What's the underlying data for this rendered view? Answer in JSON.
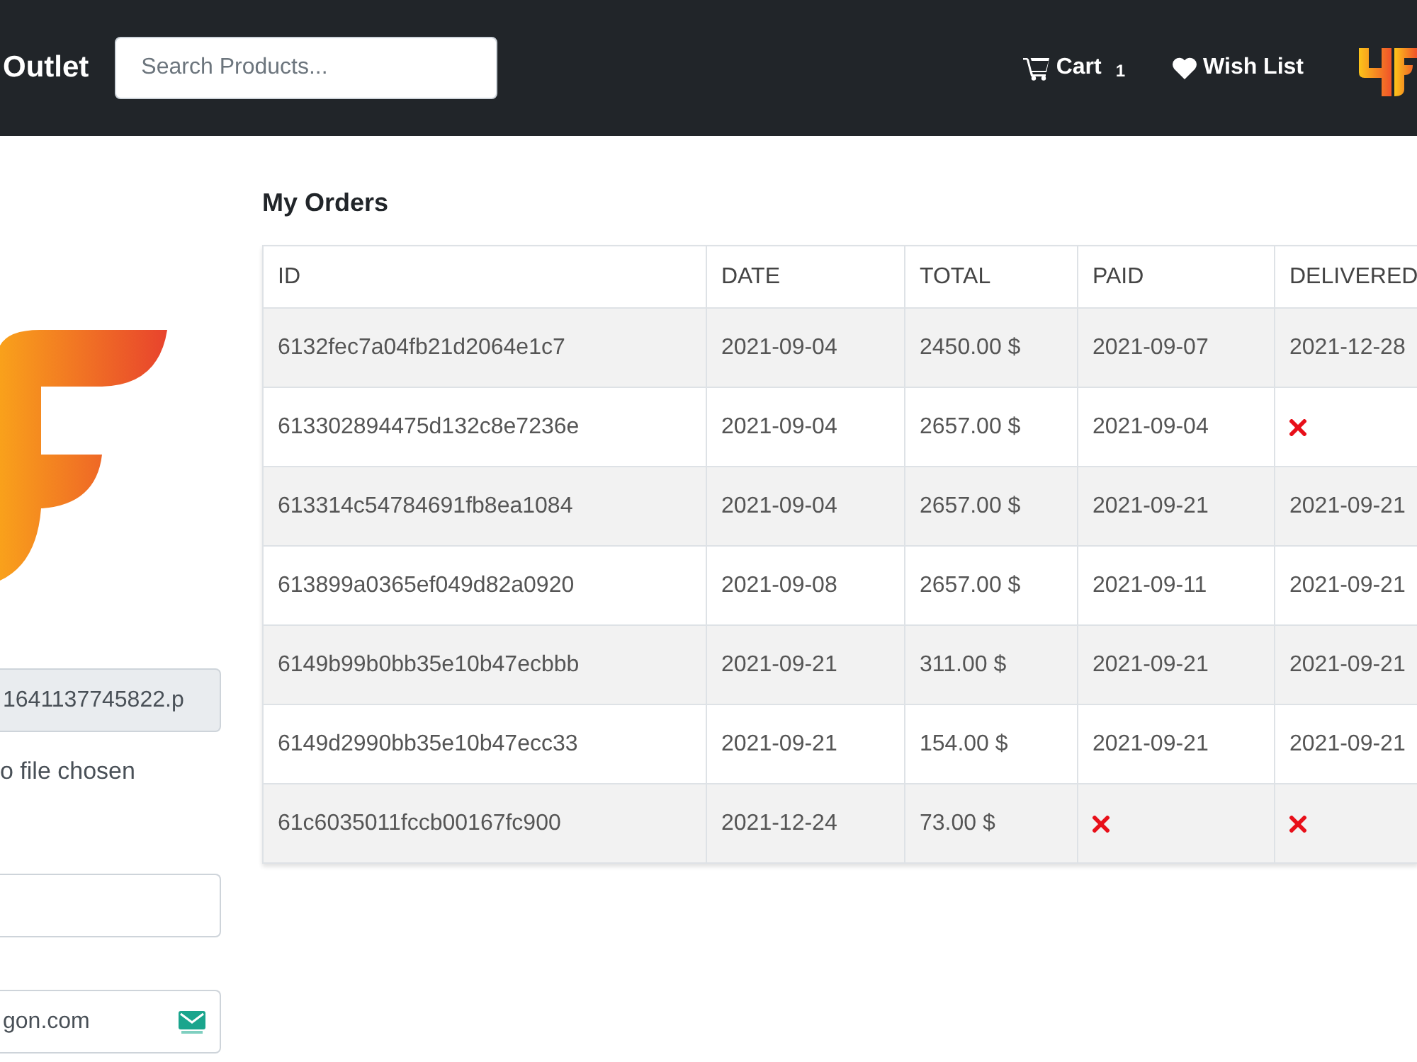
{
  "navbar": {
    "brand": "Outlet",
    "search": {
      "placeholder": "Search Products..."
    },
    "links": [
      {
        "kind": "cart",
        "label": "Cart",
        "badge": "1"
      },
      {
        "kind": "wishlist",
        "label": "Wish List"
      }
    ]
  },
  "profile": {
    "fields": [
      {
        "kind": "input",
        "value": "1641137745822.p",
        "disabled": true
      },
      {
        "kind": "note",
        "text": "o file chosen"
      },
      {
        "kind": "input",
        "disabled": false
      },
      {
        "kind": "email",
        "value": "gon.com",
        "disabled": false
      }
    ]
  },
  "orders": {
    "title": "My Orders",
    "columns": [
      "ID",
      "DATE",
      "TOTAL",
      "PAID",
      "DELIVERED"
    ],
    "rows": [
      {
        "id": "6132fec7a04fb21d2064e1c7",
        "date": "2021-09-04",
        "total": "2450.00 $",
        "paid": true,
        "paid_at": "2021-09-07",
        "delivered": true,
        "delivered_at": "2021-12-28"
      },
      {
        "id": "613302894475d132c8e7236e",
        "date": "2021-09-04",
        "total": "2657.00 $",
        "paid": true,
        "paid_at": "2021-09-04",
        "delivered": false
      },
      {
        "id": "613314c54784691fb8ea1084",
        "date": "2021-09-04",
        "total": "2657.00 $",
        "paid": true,
        "paid_at": "2021-09-21",
        "delivered": true,
        "delivered_at": "2021-09-21"
      },
      {
        "id": "613899a0365ef049d82a0920",
        "date": "2021-09-08",
        "total": "2657.00 $",
        "paid": true,
        "paid_at": "2021-09-11",
        "delivered": true,
        "delivered_at": "2021-09-21"
      },
      {
        "id": "6149b99b0bb35e10b47ecbbb",
        "date": "2021-09-21",
        "total": "311.00 $",
        "paid": true,
        "paid_at": "2021-09-21",
        "delivered": true,
        "delivered_at": "2021-09-21"
      },
      {
        "id": "6149d2990bb35e10b47ecc33",
        "date": "2021-09-21",
        "total": "154.00 $",
        "paid": true,
        "paid_at": "2021-09-21",
        "delivered": true,
        "delivered_at": "2021-09-21"
      },
      {
        "id": "61c6035011fccb00167fc900",
        "date": "2021-12-24",
        "total": "73.00 $",
        "paid": false,
        "delivered": false
      }
    ]
  }
}
